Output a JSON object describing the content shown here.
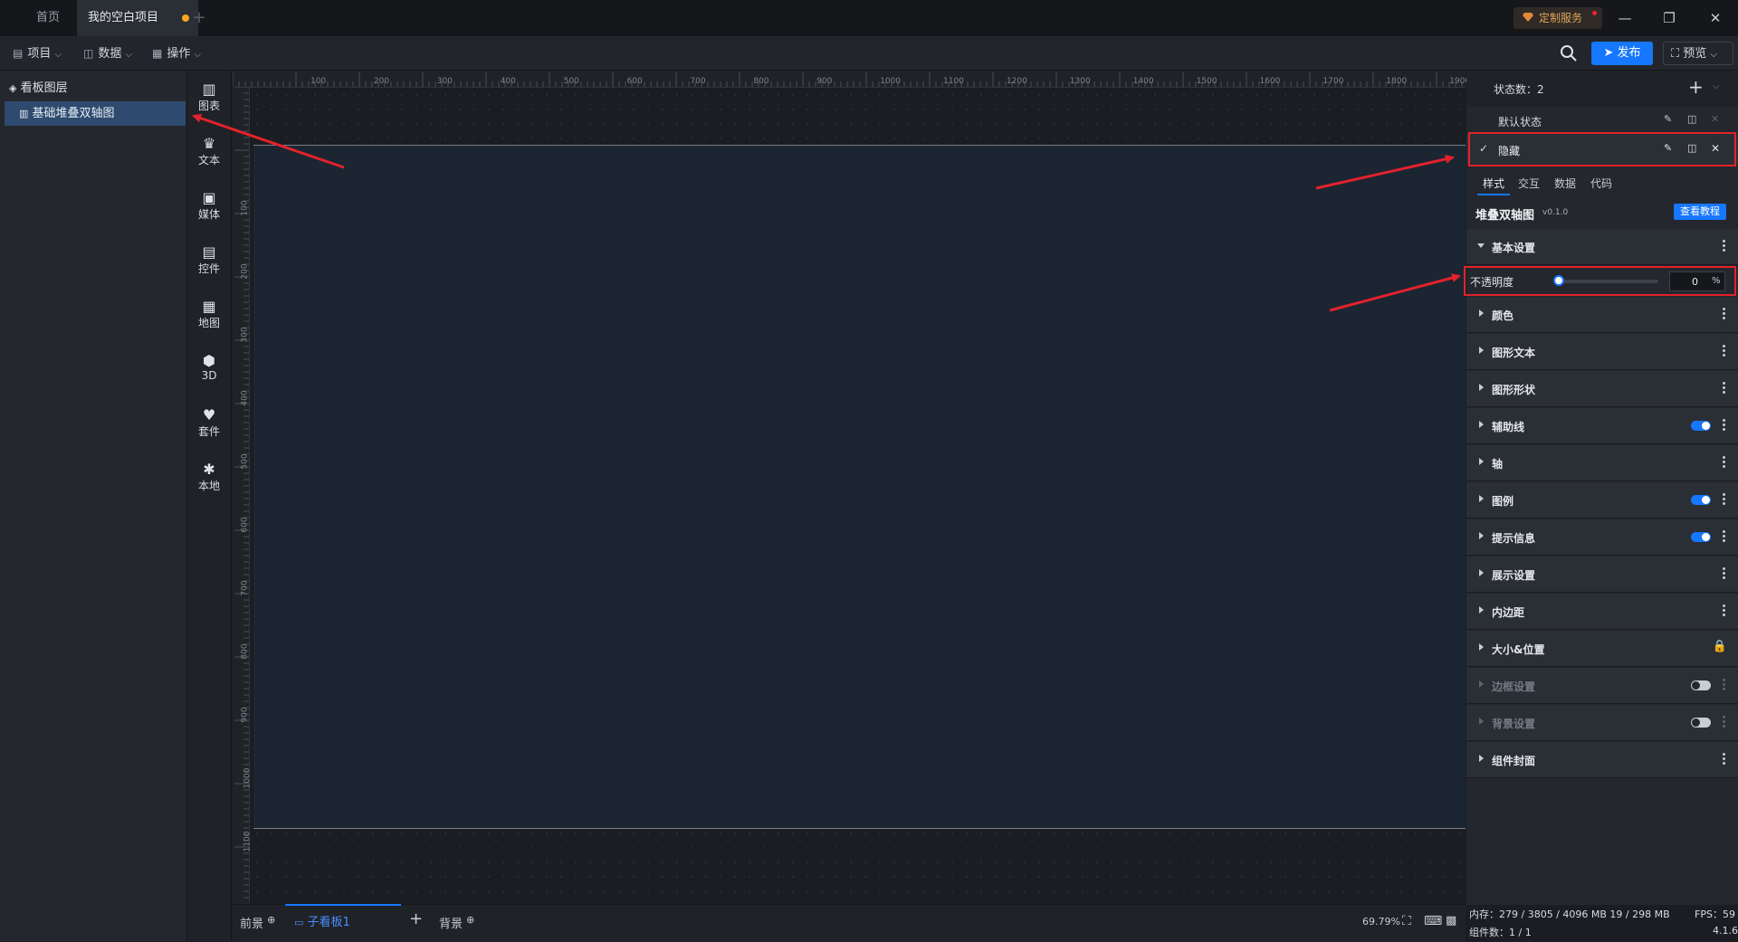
{
  "tabs": {
    "home": "首页",
    "project": "我的空白项目",
    "add": "+"
  },
  "service": {
    "label": "定制服务"
  },
  "toolbar": {
    "menus": [
      "项目",
      "数据",
      "操作"
    ],
    "publish": "发布",
    "preview": "预览"
  },
  "layers": {
    "title": "看板图层",
    "items": [
      "基础堆叠双轴图"
    ]
  },
  "components": [
    "图表",
    "文本",
    "媒体",
    "控件",
    "地图",
    "3D",
    "套件",
    "本地"
  ],
  "ruler": {
    "top": [
      "100",
      "200",
      "300",
      "400",
      "500",
      "600",
      "700",
      "800",
      "900",
      "1000",
      "1100",
      "1200",
      "1300",
      "1400",
      "1500",
      "1600",
      "1700",
      "1800",
      "1900"
    ],
    "left": [
      "100",
      "200",
      "300",
      "400",
      "500",
      "600",
      "700",
      "800",
      "900",
      "1000",
      "1100"
    ]
  },
  "bottom": {
    "front": "前景",
    "sub_board": "子看板1",
    "add": "+",
    "back": "背景",
    "zoom": "69.79%"
  },
  "right": {
    "state_count_label": "状态数：2",
    "default_state": "默认状态",
    "hidden_state": "隐藏",
    "prop_tabs": [
      "样式",
      "交互",
      "数据",
      "代码"
    ],
    "component_name": "堆叠双轴图",
    "version": "v0.1.0",
    "tutorial": "查看教程",
    "basic_settings": "基本设置",
    "opacity": {
      "label": "不透明度",
      "value": "0",
      "unit": "%",
      "level": 0
    },
    "sections": [
      {
        "label": "颜色",
        "toggle": null,
        "dim": false
      },
      {
        "label": "图形文本",
        "toggle": null,
        "dim": false
      },
      {
        "label": "图形形状",
        "toggle": null,
        "dim": false
      },
      {
        "label": "辅助线",
        "toggle": "on",
        "dim": false
      },
      {
        "label": "轴",
        "toggle": null,
        "dim": false
      },
      {
        "label": "图例",
        "toggle": "on",
        "dim": false
      },
      {
        "label": "提示信息",
        "toggle": "on",
        "dim": false
      },
      {
        "label": "展示设置",
        "toggle": null,
        "dim": false
      },
      {
        "label": "内边距",
        "toggle": null,
        "dim": false
      },
      {
        "label": "大小&位置",
        "toggle": "lock",
        "dim": false
      },
      {
        "label": "边框设置",
        "toggle": "off",
        "dim": true
      },
      {
        "label": "背景设置",
        "toggle": "off",
        "dim": true
      },
      {
        "label": "组件封面",
        "toggle": null,
        "dim": false
      }
    ]
  },
  "status": {
    "memory": "内存：279 / 3805 / 4096 MB 19 / 298 MB",
    "fps": "FPS：59",
    "components": "组件数：1 / 1",
    "version": "4.1.6"
  },
  "colors": {
    "accent": "#1677ff",
    "annotation": "#e2222c",
    "canvas": "#1c2532"
  }
}
